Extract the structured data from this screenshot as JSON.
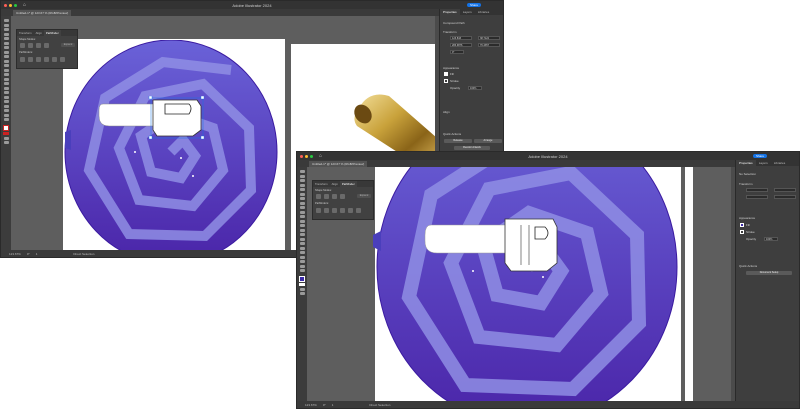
{
  "window_back": {
    "app_title": "Adobe Illustrator 2024",
    "share_label": "Share",
    "doc_tab": "Untitled-1* @ 123.67 % (RGB/Preview)",
    "status": {
      "zoom": "123.67%",
      "angle": "0°",
      "artboard": "1",
      "tool": "Direct Selection"
    },
    "panel_tabs": [
      "Properties",
      "Layers",
      "Libraries"
    ],
    "section_selection": "Compound Path",
    "section_transform": "Transform",
    "transform_fields": {
      "x": "123.843",
      "y": "283.9876",
      "w": "38.7122",
      "h": "76.4357",
      "angle": "0°"
    },
    "section_appearance": "Appearance",
    "fill_label": "Fill",
    "stroke_label": "Stroke",
    "opacity_label": "Opacity",
    "opacity_value": "100%",
    "section_align": "Align",
    "section_quick_actions": "Quick Actions",
    "release_label": "Release",
    "arrange_label": "Arrange",
    "recolor_label": "Recolor Artwork",
    "floating_tabs": [
      "Transform",
      "Align",
      "Pathfinder"
    ],
    "shape_modes_label": "Shape Modes:",
    "pathfinders_label": "Pathfinders:",
    "expand_label": "Expand"
  },
  "window_front": {
    "app_title": "Adobe Illustrator 2024",
    "share_label": "Share",
    "doc_tab": "Untitled-1* @ 123.67 % (RGB/Preview)",
    "status": {
      "zoom": "123.67%",
      "angle": "0°",
      "artboard": "1",
      "tool": "Direct Selection"
    },
    "panel_tabs": [
      "Properties",
      "Layers",
      "Libraries"
    ],
    "section_selection": "No Selection",
    "section_transform": "Transform",
    "section_appearance": "Appearance",
    "fill_label": "Fill",
    "stroke_label": "Stroke",
    "opacity_label": "Opacity",
    "opacity_value": "100%",
    "section_quick_actions": "Quick Actions",
    "document_setup_label": "Document Setup",
    "floating_tabs": [
      "Transform",
      "Align",
      "Pathfinder"
    ],
    "shape_modes_label": "Shape Modes:",
    "pathfinders_label": "Pathfinders:",
    "expand_label": "Expand"
  },
  "colors": {
    "circle_top": "#6a62d8",
    "circle_bottom": "#4a24a8",
    "spiral": "#8f8ee4",
    "app_dark": "#333333",
    "panel": "#3e3e3e",
    "accent": "#1473e6",
    "gold": "#c9a23b"
  },
  "icons": [
    "close-icon",
    "minimize-icon",
    "maximize-icon",
    "home-icon",
    "share-icon",
    "selection-tool-icon",
    "direct-selection-tool-icon",
    "pen-tool-icon",
    "type-tool-icon",
    "rectangle-tool-icon",
    "zoom-tool-icon",
    "fill-swatch-icon",
    "stroke-swatch-icon"
  ]
}
